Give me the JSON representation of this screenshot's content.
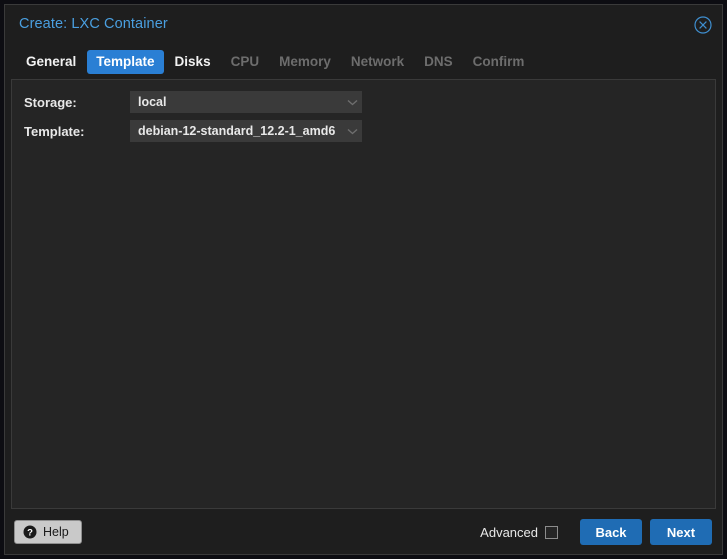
{
  "window": {
    "title": "Create: LXC Container",
    "close_icon": "close-circle-icon",
    "accent_blue": "#2a7fd4",
    "title_color": "#4a9fe0",
    "body_bg": "#252525",
    "chrome_bg": "#1e1e1e"
  },
  "tabs": [
    {
      "label": "General",
      "state": "enabled"
    },
    {
      "label": "Template",
      "state": "active"
    },
    {
      "label": "Disks",
      "state": "enabled"
    },
    {
      "label": "CPU",
      "state": "disabled"
    },
    {
      "label": "Memory",
      "state": "disabled"
    },
    {
      "label": "Network",
      "state": "disabled"
    },
    {
      "label": "DNS",
      "state": "disabled"
    },
    {
      "label": "Confirm",
      "state": "disabled"
    }
  ],
  "form": {
    "storage": {
      "label": "Storage:",
      "value": "local",
      "arrow_icon": "chevron-down-icon"
    },
    "template": {
      "label": "Template:",
      "value": "debian-12-standard_12.2-1_amd6",
      "arrow_icon": "chevron-down-icon"
    }
  },
  "footer": {
    "help_label": "Help",
    "help_icon": "question-mark-circle-icon",
    "advanced_label": "Advanced",
    "advanced_checked": false,
    "back_label": "Back",
    "next_label": "Next",
    "button_color": "#1f6cb4"
  }
}
